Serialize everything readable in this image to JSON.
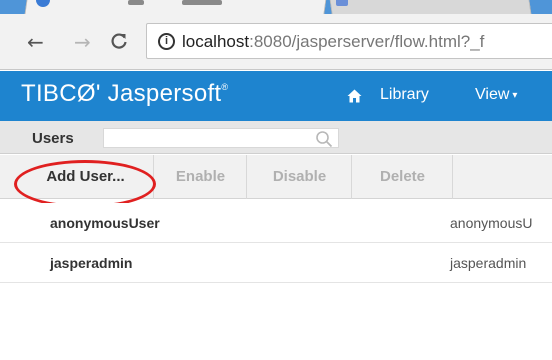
{
  "browser": {
    "url_host": "localhost",
    "url_rest": ":8080/jasperserver/flow.html?_f",
    "info_icon": "info-icon",
    "nav": {
      "back": "←",
      "forward": "→",
      "reload": "C"
    }
  },
  "app": {
    "brand": "TIBCØ' Jaspersoft",
    "brand_reg": "®",
    "menu": {
      "library": "Library",
      "view": "View",
      "view_caret": "▾"
    }
  },
  "users_panel": {
    "title": "Users",
    "search_placeholder": "",
    "search_value": ""
  },
  "actions": {
    "add_user": "Add User...",
    "enable": "Enable",
    "disable": "Disable",
    "delete": "Delete"
  },
  "users": [
    {
      "name": "anonymousUser",
      "id": "anonymousU"
    },
    {
      "name": "jasperadmin",
      "id": "jasperadmin"
    }
  ],
  "colors": {
    "header_blue": "#1e84cf",
    "annotation_red": "#e02020"
  }
}
